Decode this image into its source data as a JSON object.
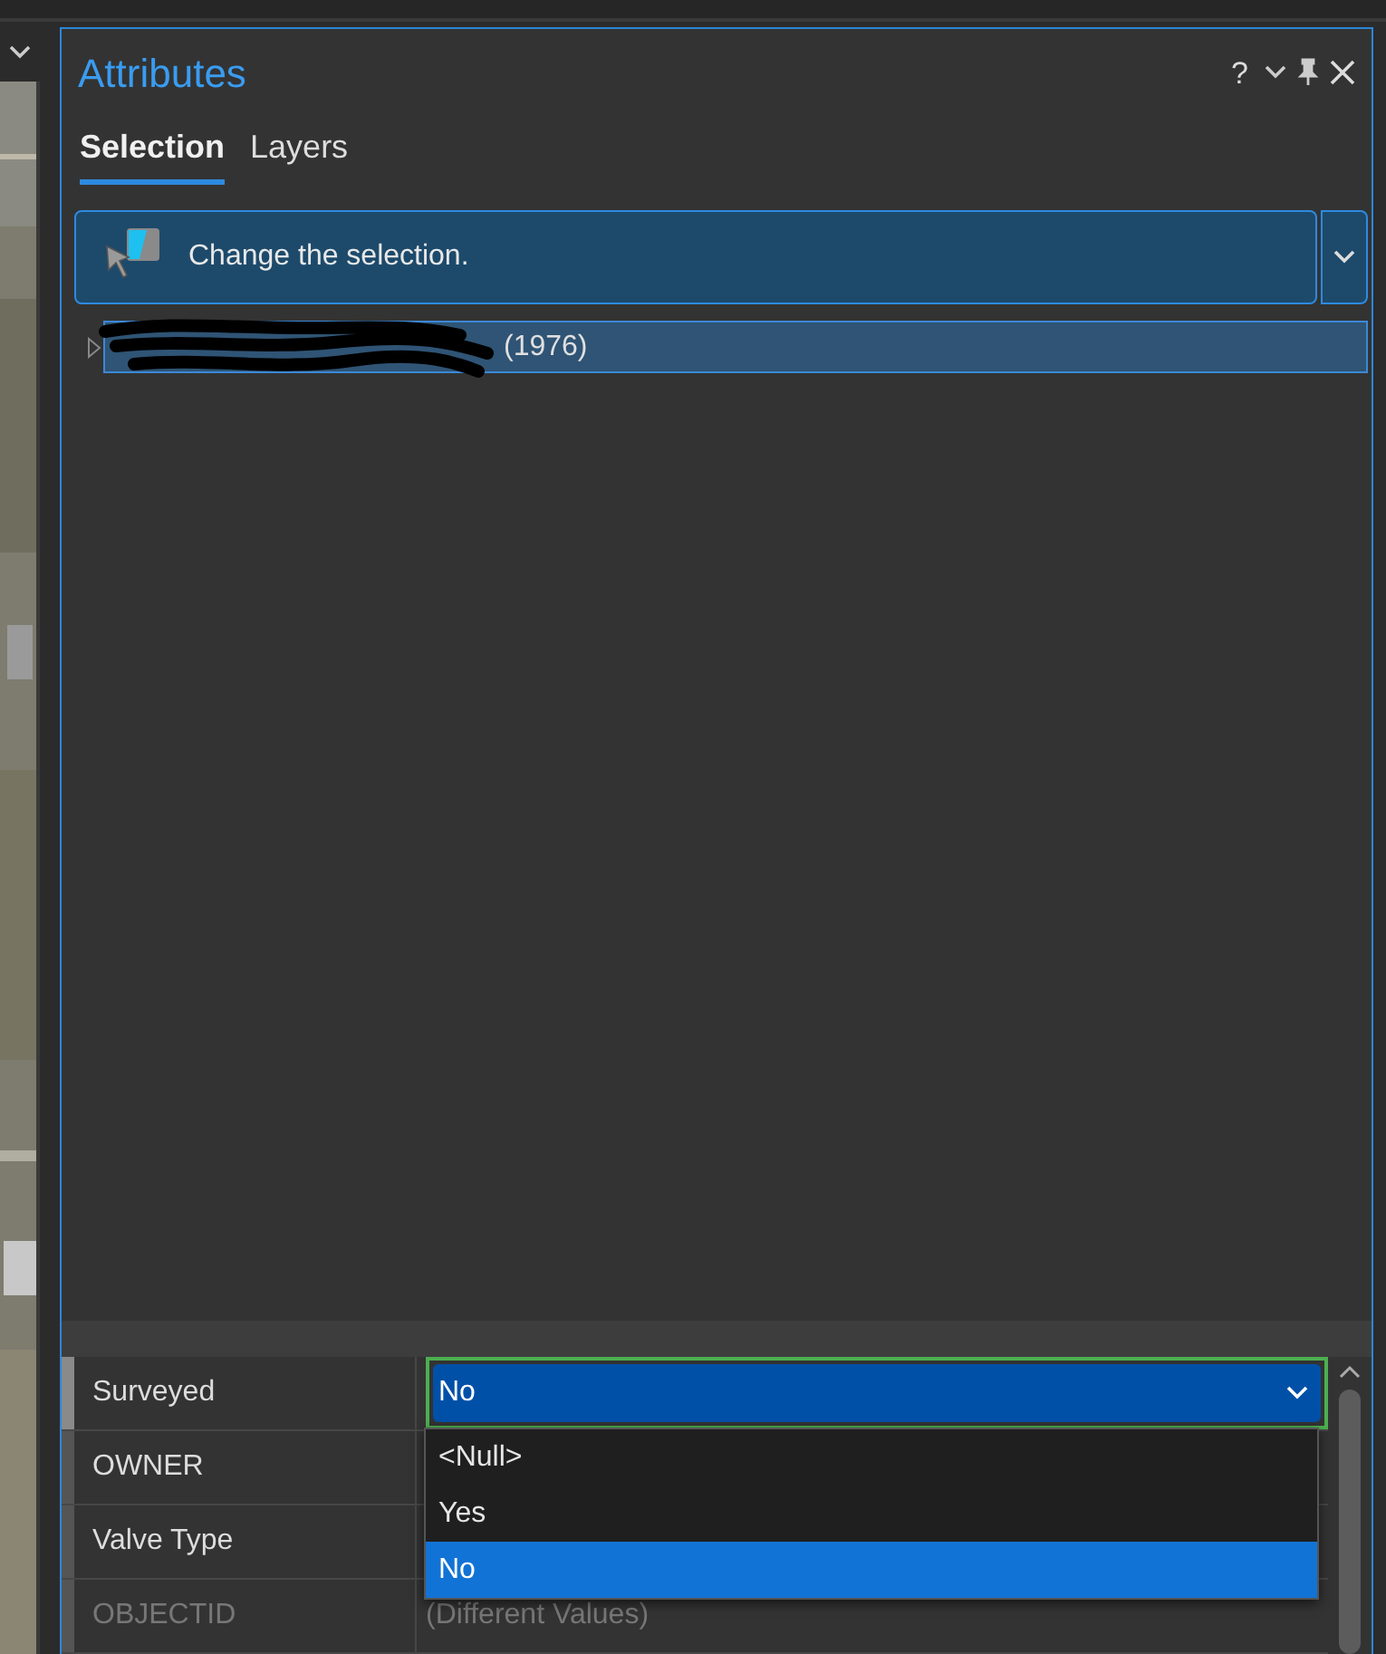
{
  "panel": {
    "title": "Attributes",
    "help": "?"
  },
  "tabs": [
    {
      "label": "Selection",
      "selected": true
    },
    {
      "label": "Layers",
      "selected": false
    }
  ],
  "selection_tool": {
    "label": "Change the selection."
  },
  "tree": [
    {
      "label": "(1976)",
      "expanded": false,
      "selected": true,
      "redacted": true
    }
  ],
  "attributes": [
    {
      "name": "Surveyed",
      "value": "No",
      "editing": true,
      "disabled": false
    },
    {
      "name": "OWNER",
      "disabled": false,
      "editing": false
    },
    {
      "name": "Valve Type",
      "disabled": false,
      "editing": false
    },
    {
      "name": "OBJECTID",
      "value": "(Different Values)",
      "disabled": true,
      "editing": false
    }
  ],
  "dropdown": {
    "options": [
      {
        "label": "<Null>",
        "selected": false
      },
      {
        "label": "Yes",
        "selected": false
      },
      {
        "label": "No",
        "selected": true
      }
    ]
  }
}
